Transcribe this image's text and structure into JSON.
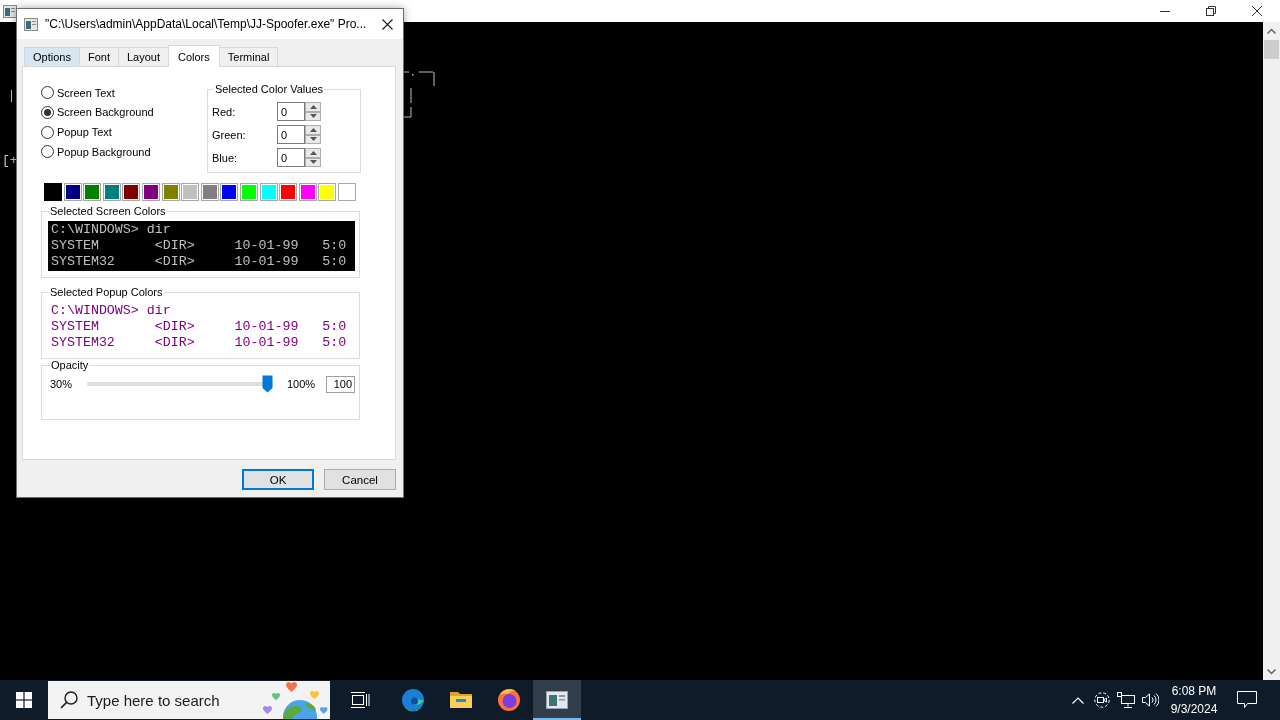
{
  "console_window": {
    "visible_text": "[+"
  },
  "dialog": {
    "title": "\"C:\\Users\\admin\\AppData\\Local\\Temp\\JJ-Spoofer.exe\" Pro...",
    "tabs": [
      {
        "label": "Options",
        "selected": false,
        "hovered": true
      },
      {
        "label": "Font",
        "selected": false,
        "hovered": false
      },
      {
        "label": "Layout",
        "selected": false,
        "hovered": false
      },
      {
        "label": "Colors",
        "selected": true,
        "hovered": false
      },
      {
        "label": "Terminal",
        "selected": false,
        "hovered": false
      }
    ],
    "color_targets": [
      {
        "label": "Screen Text",
        "selected": false
      },
      {
        "label": "Screen Background",
        "selected": true
      },
      {
        "label": "Popup Text",
        "selected": false
      },
      {
        "label": "Popup Background",
        "selected": false
      }
    ],
    "color_values": {
      "title": "Selected Color Values",
      "fields": [
        {
          "label": "Red:",
          "value": "0"
        },
        {
          "label": "Green:",
          "value": "0"
        },
        {
          "label": "Blue:",
          "value": "0"
        }
      ]
    },
    "palette": [
      {
        "color": "#000000",
        "selected": true
      },
      {
        "color": "#000080",
        "selected": false
      },
      {
        "color": "#008000",
        "selected": false
      },
      {
        "color": "#008080",
        "selected": false
      },
      {
        "color": "#800000",
        "selected": false
      },
      {
        "color": "#800080",
        "selected": false
      },
      {
        "color": "#808000",
        "selected": false
      },
      {
        "color": "#c0c0c0",
        "selected": false
      },
      {
        "color": "#808080",
        "selected": false
      },
      {
        "color": "#0000ff",
        "selected": false
      },
      {
        "color": "#00ff00",
        "selected": false
      },
      {
        "color": "#00ffff",
        "selected": false
      },
      {
        "color": "#ff0000",
        "selected": false
      },
      {
        "color": "#ff00ff",
        "selected": false
      },
      {
        "color": "#ffff00",
        "selected": false
      },
      {
        "color": "#ffffff",
        "selected": false
      }
    ],
    "screen_colors": {
      "title": "Selected Screen Colors",
      "lines": [
        "C:\\WINDOWS> dir",
        "SYSTEM       <DIR>     10-01-99   5:0",
        "SYSTEM32     <DIR>     10-01-99   5:0"
      ]
    },
    "popup_colors": {
      "title": "Selected Popup Colors",
      "lines": [
        "C:\\WINDOWS> dir",
        "SYSTEM       <DIR>     10-01-99   5:0",
        "SYSTEM32     <DIR>     10-01-99   5:0"
      ]
    },
    "opacity": {
      "title": "Opacity",
      "min_label": "30%",
      "max_label": "100%",
      "level": 1,
      "value": "100"
    },
    "buttons": [
      {
        "label": "OK",
        "default": true
      },
      {
        "label": "Cancel",
        "default": false
      }
    ]
  },
  "taskbar": {
    "search": {
      "placeholder": "Type here to search"
    },
    "apps": [
      {
        "kind": "edge",
        "active": false
      },
      {
        "kind": "explorer",
        "active": false
      },
      {
        "kind": "firefox",
        "active": false
      },
      {
        "kind": "console",
        "active": true
      }
    ],
    "clock": {
      "time": "6:08 PM",
      "date": "9/3/2024"
    }
  }
}
